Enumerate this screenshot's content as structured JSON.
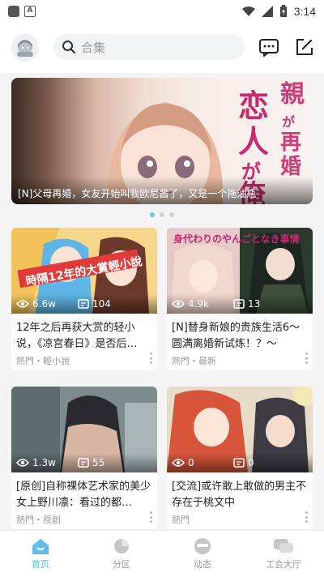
{
  "status_bar": {
    "time": "3:14"
  },
  "search": {
    "placeholder": "合集"
  },
  "banner": {
    "title_art": "親が再婚。恋人が俺",
    "caption": "[N]父母再婚，女友开始叫我欧尼酱了，又是一个拖油瓶",
    "page_count": 3,
    "active_page": 1
  },
  "cards": [
    {
      "views": "6.6w",
      "comments": "104",
      "title": "12年之后再获大赏的轻小说，《凉宫春日》是否后…",
      "meta": "熱門・輕小說",
      "cover_text": "時隔12年的大賞輕小說"
    },
    {
      "views": "4.9k",
      "comments": "13",
      "title": "[N]替身新娘的贵族生活6～圆满离婚新试炼！？～",
      "meta": "熱門・最新",
      "cover_text": "身代わりのやんごとなき事情"
    },
    {
      "views": "1.3w",
      "comments": "55",
      "title": "[原创]自称裸体艺术家的美少女上野川凛：看过的都…",
      "meta": "熱門・原創"
    },
    {
      "views": "0",
      "comments": "0",
      "title": "[交流]或许敢上敢做的男主不存在于桃文中",
      "meta": "熱門"
    }
  ],
  "nav": [
    {
      "label": "首页",
      "active": true
    },
    {
      "label": "分区",
      "active": false
    },
    {
      "label": "动态",
      "active": false
    },
    {
      "label": "工会大厅",
      "active": false
    }
  ],
  "colors": {
    "accent": "#5fbfe8",
    "dot_active": "#6ec3e8"
  }
}
